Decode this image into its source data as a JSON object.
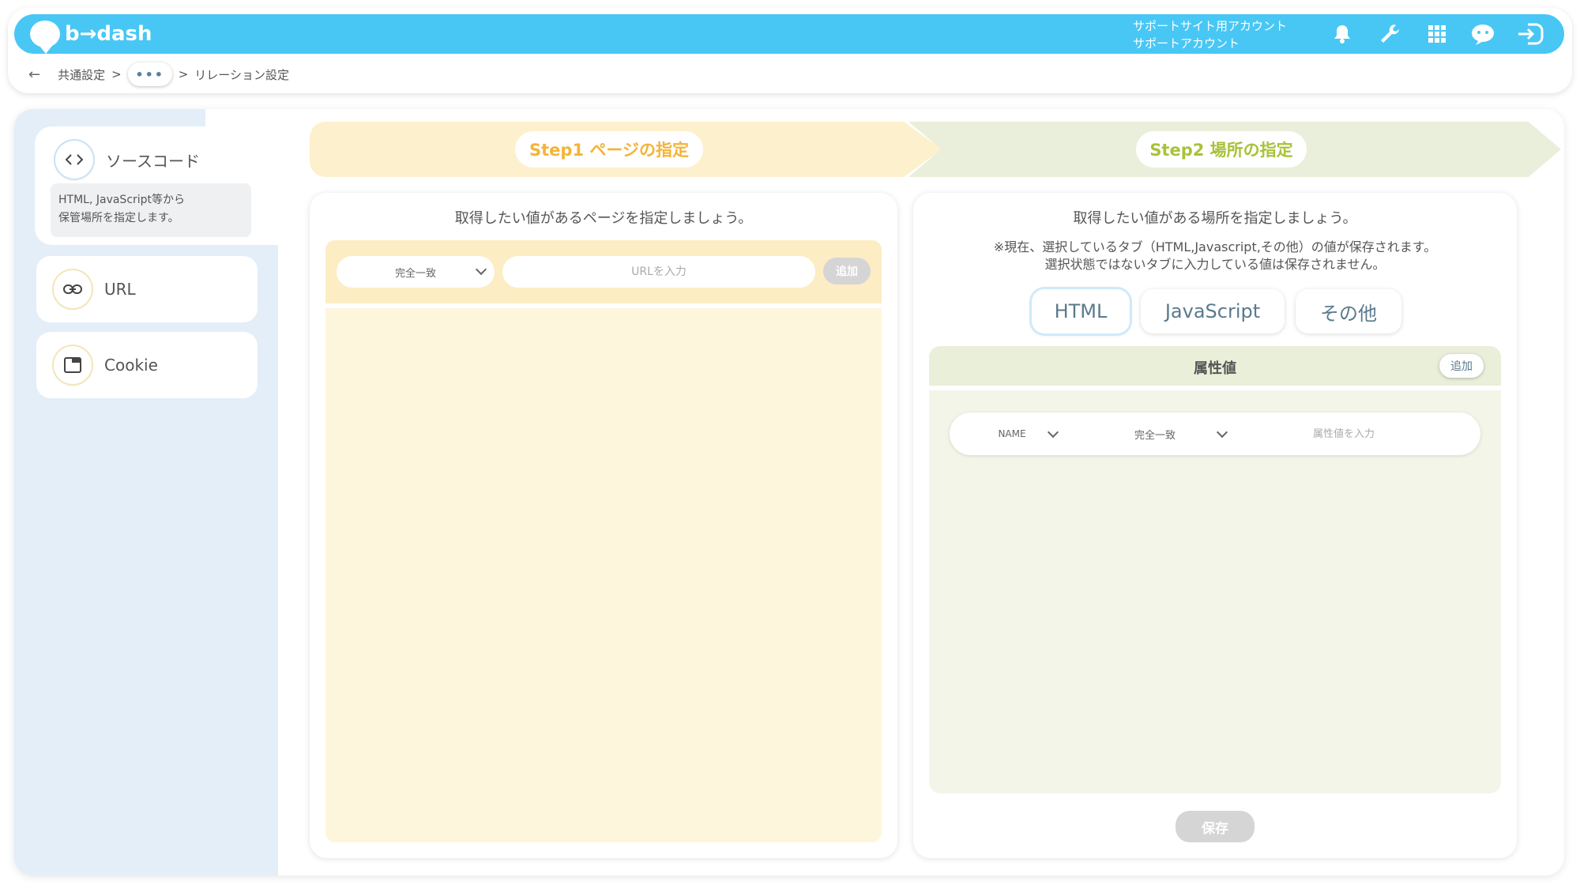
{
  "header": {
    "logo_text": "b→dash",
    "account_line1": "サポートサイト用アカウント",
    "account_line2": "サポートアカウント",
    "icons": [
      "bell-icon",
      "wrench-icon",
      "grid-icon",
      "chat-bot-icon",
      "logout-icon"
    ]
  },
  "breadcrumb": {
    "back": "←",
    "item1": "共通設定",
    "sep": ">",
    "more": "•••",
    "current": "リレーション設定"
  },
  "sidebar": {
    "items": [
      {
        "label": "ソースコード",
        "icon": "code-icon",
        "description_line1": "HTML, JavaScript等から",
        "description_line2": "保管場所を指定します。"
      },
      {
        "label": "URL",
        "icon": "link-icon"
      },
      {
        "label": "Cookie",
        "icon": "window-icon"
      }
    ]
  },
  "steps": {
    "step1": "Step1 ページの指定",
    "step2": "Step2 場所の指定"
  },
  "left_panel": {
    "title": "取得したい値があるページを指定しましょう。",
    "match_select": "完全一致",
    "url_placeholder": "URLを入力",
    "add_button": "追加"
  },
  "right_panel": {
    "title": "取得したい値がある場所を指定しましょう。",
    "note_line1": "※現在、選択しているタブ（HTML,Javascript,その他）の値が保存されます。",
    "note_line2": "選択状態ではないタブに入力している値は保存されません。",
    "tabs": [
      "HTML",
      "JavaScript",
      "その他"
    ],
    "attr_header": "属性値",
    "attr_add": "追加",
    "attr_select1": "NAME",
    "attr_select2": "完全一致",
    "attr_placeholder": "属性値を入力",
    "save_button": "保存"
  },
  "colors": {
    "header_blue": "#48c7f5",
    "step1_bg": "#fdf0cc",
    "step1_text": "#f5b338",
    "step2_bg": "#eaefdb",
    "step2_text": "#a8c23a",
    "sidebar_bg": "#e3eef8"
  }
}
